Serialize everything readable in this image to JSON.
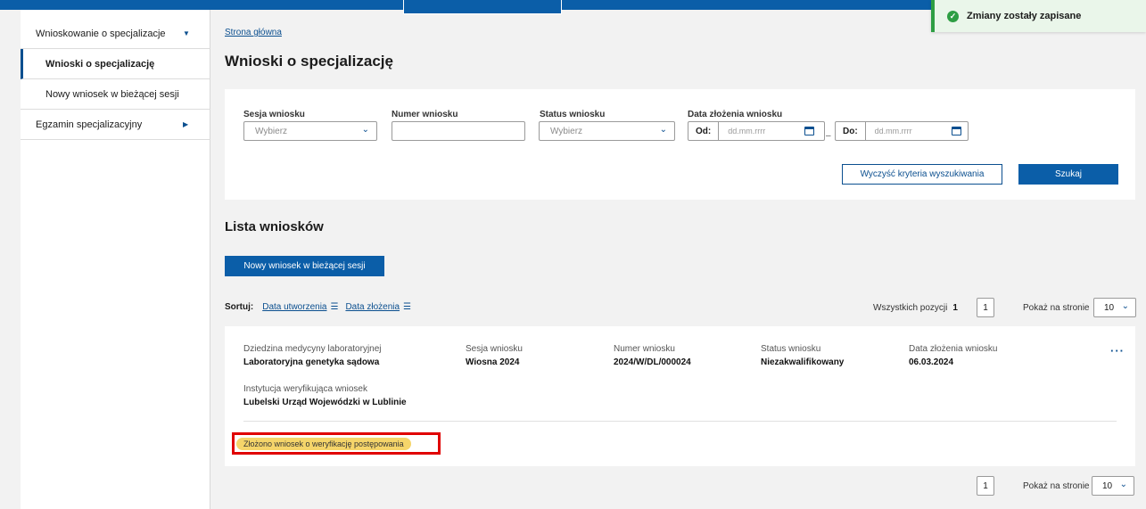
{
  "toast": {
    "message": "Zmiany zostały zapisane",
    "icon": "check-circle-icon"
  },
  "sidebar": {
    "items": [
      {
        "label": "Wnioskowanie o specjalizacje",
        "icon": "caret-down-icon"
      },
      {
        "label": "Wnioski o specjalizację"
      },
      {
        "label": "Nowy wniosek w bieżącej sesji"
      },
      {
        "label": "Egzamin specjalizacyjny",
        "icon": "caret-right-icon"
      }
    ]
  },
  "breadcrumb": "Strona główna",
  "page_title": "Wnioski o specjalizację",
  "filters": {
    "session": {
      "label": "Sesja wniosku",
      "placeholder": "Wybierz"
    },
    "number": {
      "label": "Numer wniosku",
      "value": ""
    },
    "status": {
      "label": "Status wniosku",
      "placeholder": "Wybierz"
    },
    "date": {
      "label": "Data złożenia wniosku",
      "from_label": "Od:",
      "to_label": "Do:",
      "placeholder": "dd.mm.rrrr",
      "separator": "–"
    },
    "clear_button": "Wyczyść kryteria wyszukiwania",
    "search_button": "Szukaj"
  },
  "list": {
    "title": "Lista wniosków",
    "new_button": "Nowy wniosek w bieżącej sesji",
    "sort_label": "Sortuj:",
    "sort_created": "Data utworzenia",
    "sort_submitted": "Data złożenia",
    "total_label": "Wszystkich pozycji",
    "total_value": "1",
    "page": "1",
    "per_page_label": "Pokaż na stronie",
    "per_page_value": "10"
  },
  "row": {
    "field_label": "Dziedzina medycyny laboratoryjnej",
    "field_value": "Laboratoryjna genetyka sądowa",
    "session_label": "Sesja wniosku",
    "session_value": "Wiosna 2024",
    "number_label": "Numer wniosku",
    "number_value": "2024/W/DL/000024",
    "status_label": "Status wniosku",
    "status_value": "Niezakwalifikowany",
    "date_label": "Data złożenia wniosku",
    "date_value": "06.03.2024",
    "institution_label": "Instytucja weryfikująca wniosek",
    "institution_value": "Lubelski Urząd Wojewódzki w Lublinie",
    "badge": "Złożono wniosek o weryfikację postępowania",
    "more": "···"
  },
  "colors": {
    "primary": "#0b5ea8",
    "highlight": "#e00000",
    "badge": "#f5d56a",
    "success": "#2e9e44"
  }
}
